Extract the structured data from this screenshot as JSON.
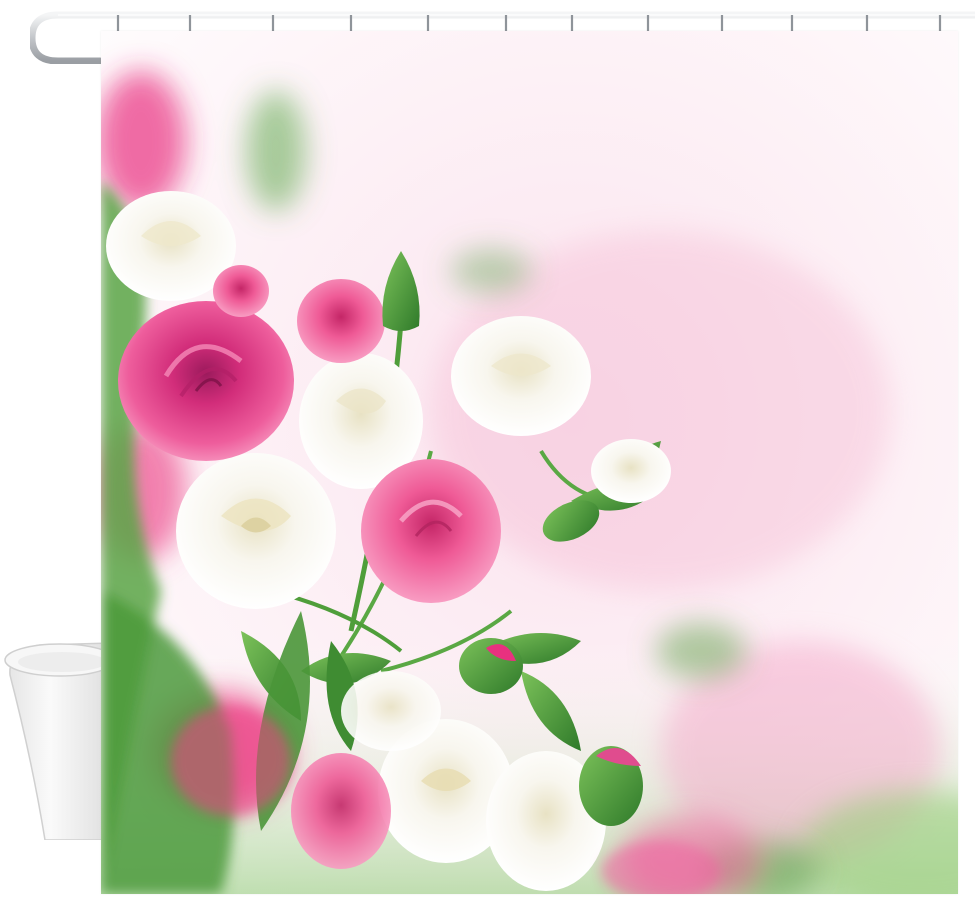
{
  "scene": {
    "subject": "rose-shower-curtain",
    "colors": {
      "background": "#ffffff",
      "rod": "#c9ccd0",
      "tub": "#f2f2f2",
      "rose_pink": "#e8317f",
      "rose_light_pink": "#f07bae",
      "rose_white": "#f6f4ec",
      "leaf_green": "#4f9e3a",
      "haze_pink": "#f9d5e4"
    },
    "icons": [
      "curtain-rod",
      "curtain-ring",
      "bathtub-icon",
      "rose-icon",
      "rosebud-icon",
      "leaf-icon"
    ]
  }
}
